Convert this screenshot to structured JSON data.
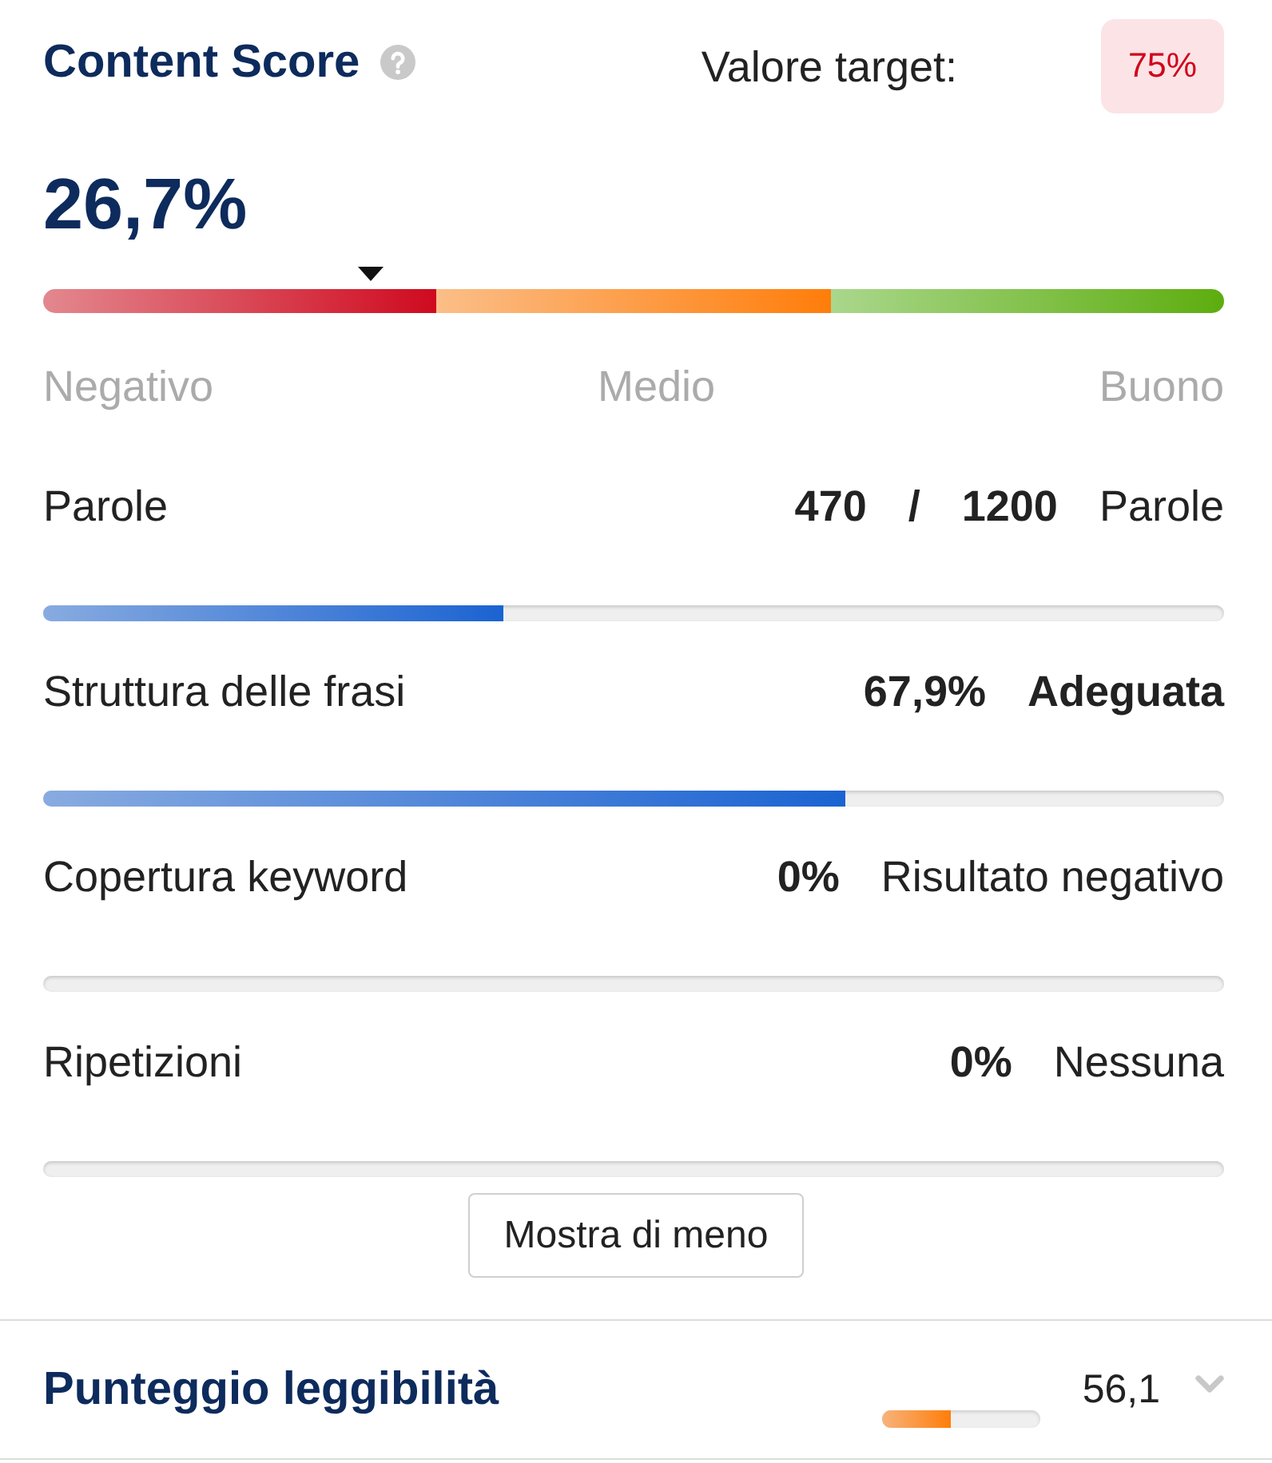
{
  "header": {
    "title": "Content Score",
    "target_label": "Valore target:",
    "target_value": "75%"
  },
  "score": {
    "value": "26,7%",
    "level": 0.267,
    "scale": [
      "Negativo",
      "Medio",
      "Buono"
    ]
  },
  "metrics": [
    {
      "label": "Parole",
      "values": [
        {
          "text": "470",
          "bold": true
        },
        {
          "text": "/",
          "bold": true
        },
        {
          "text": "1200",
          "bold": true
        },
        {
          "text": "Parole",
          "bold": false
        }
      ],
      "level": 0.39
    },
    {
      "label": "Struttura delle frasi",
      "values": [
        {
          "text": "67,9%",
          "bold": true
        },
        {
          "text": "Adeguata",
          "bold": true
        }
      ],
      "level": 0.679
    },
    {
      "label": "Copertura keyword",
      "values": [
        {
          "text": "0%",
          "bold": true
        },
        {
          "text": "Risultato negativo",
          "bold": false
        }
      ],
      "level": 0
    },
    {
      "label": "Ripetizioni",
      "values": [
        {
          "text": "0%",
          "bold": true
        },
        {
          "text": "Nessuna",
          "bold": false
        }
      ],
      "level": 0
    }
  ],
  "toggle_button": {
    "label": "Mostra di meno"
  },
  "readability": {
    "title": "Punteggio leggibilità",
    "level": 0.43,
    "value": "56,1",
    "expanded": false
  }
}
